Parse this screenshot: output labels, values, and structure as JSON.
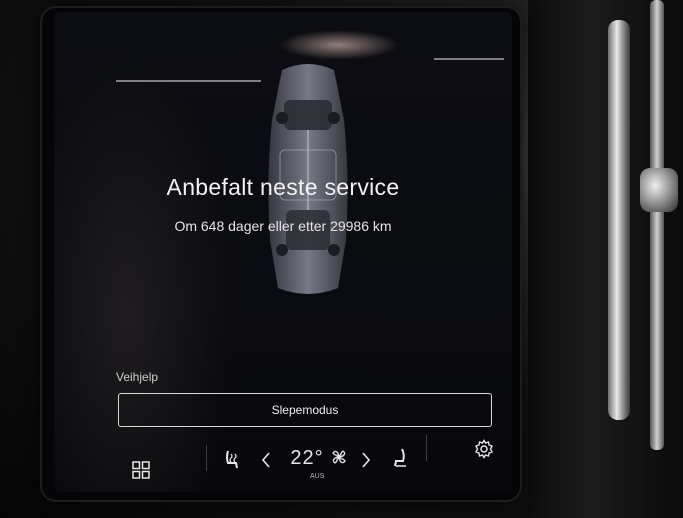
{
  "service": {
    "title": "Anbefalt neste service",
    "subtitle": "Om 648 dager eller etter 29986 km"
  },
  "roadside": {
    "label": "Veihjelp",
    "tow_button": "Slepemodus"
  },
  "climate_bar": {
    "temperature": "22°",
    "auto_label": "AUS"
  },
  "icons": {
    "home": "grid-icon",
    "seat_heat_left": "seat-heat-icon",
    "temp_down": "chevron-left-icon",
    "fan": "fan-icon",
    "temp_up": "chevron-right-icon",
    "seat_right": "seat-icon",
    "settings": "gear-icon"
  },
  "colors": {
    "screen_bg": "#0a0b10",
    "text": "#f2f2f2",
    "button_border": "#d8d8d8"
  }
}
